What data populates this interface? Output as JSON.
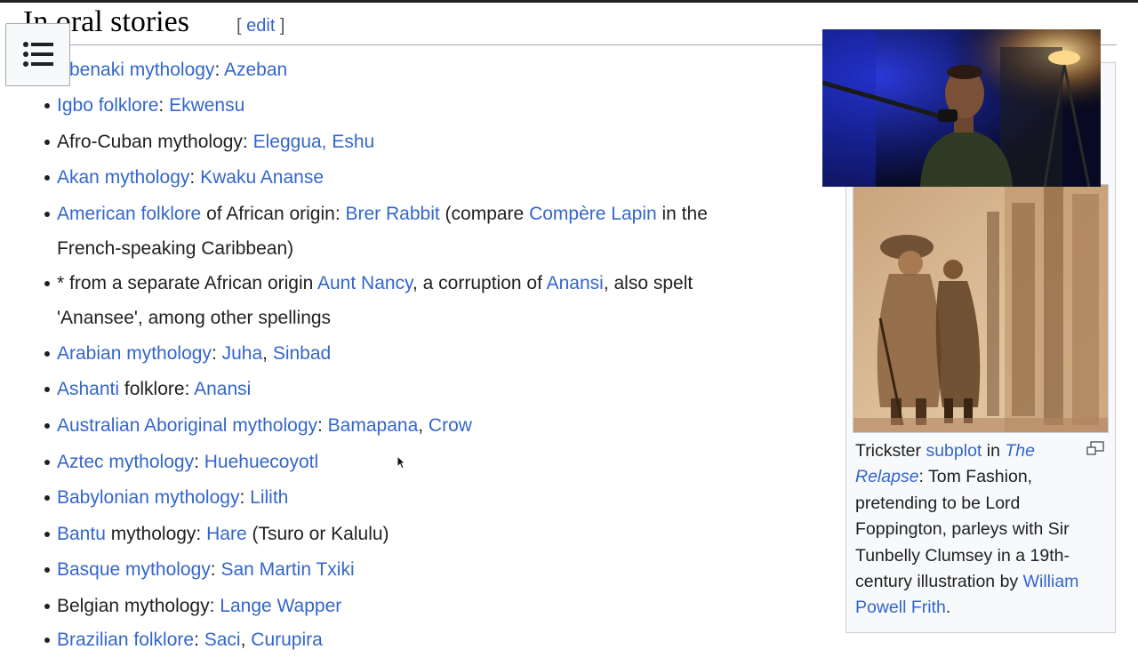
{
  "section": {
    "title": "In oral stories",
    "edit_open": "[ ",
    "edit_label": "edit",
    "edit_close": " ]"
  },
  "toc_button": {
    "icon": "menu-list-icon"
  },
  "items": [
    {
      "segments": [
        {
          "text": "Abenaki mythology",
          "link": true
        },
        {
          "text": ": "
        },
        {
          "text": "Azeban",
          "link": true
        }
      ]
    },
    {
      "segments": [
        {
          "text": "Igbo folklore",
          "link": true
        },
        {
          "text": ": "
        },
        {
          "text": "Ekwensu",
          "link": true
        }
      ]
    },
    {
      "segments": [
        {
          "text": "Afro-Cuban mythology: "
        },
        {
          "text": "Eleggua, Eshu",
          "link": true
        }
      ]
    },
    {
      "segments": [
        {
          "text": "Akan mythology",
          "link": true
        },
        {
          "text": ": "
        },
        {
          "text": "Kwaku Ananse",
          "link": true
        }
      ]
    },
    {
      "segments": [
        {
          "text": "American folklore",
          "link": true
        },
        {
          "text": " of African origin: "
        },
        {
          "text": "Brer Rabbit",
          "link": true
        },
        {
          "text": " (compare "
        },
        {
          "text": "Compère Lapin",
          "link": true
        },
        {
          "text": " in the"
        },
        {
          "text": "French-speaking Caribbean)",
          "newline": true
        }
      ]
    },
    {
      "segments": [
        {
          "text": "* from a separate African origin "
        },
        {
          "text": "Aunt Nancy",
          "link": true
        },
        {
          "text": ", a corruption of "
        },
        {
          "text": "Anansi",
          "link": true
        },
        {
          "text": ", also spelt"
        },
        {
          "text": "'Anansee', among other spellings",
          "newline": true
        }
      ]
    },
    {
      "segments": [
        {
          "text": "Arabian mythology",
          "link": true
        },
        {
          "text": ": "
        },
        {
          "text": "Juha",
          "link": true
        },
        {
          "text": ", "
        },
        {
          "text": "Sinbad",
          "link": true
        }
      ]
    },
    {
      "segments": [
        {
          "text": "Ashanti",
          "link": true
        },
        {
          "text": " folklore: "
        },
        {
          "text": "Anansi",
          "link": true
        }
      ]
    },
    {
      "segments": [
        {
          "text": "Australian Aboriginal mythology",
          "link": true
        },
        {
          "text": ": "
        },
        {
          "text": "Bamapana",
          "link": true
        },
        {
          "text": ", "
        },
        {
          "text": "Crow",
          "link": true
        }
      ]
    },
    {
      "segments": [
        {
          "text": "Aztec mythology",
          "link": true
        },
        {
          "text": ": "
        },
        {
          "text": "Huehuecoyotl",
          "link": true
        }
      ]
    },
    {
      "segments": [
        {
          "text": "Babylonian mythology",
          "link": true
        },
        {
          "text": ": "
        },
        {
          "text": "Lilith",
          "link": true
        }
      ]
    },
    {
      "segments": [
        {
          "text": "Bantu",
          "link": true
        },
        {
          "text": " mythology: "
        },
        {
          "text": "Hare",
          "link": true
        },
        {
          "text": " (Tsuro or Kalulu)"
        }
      ]
    },
    {
      "segments": [
        {
          "text": "Basque mythology",
          "link": true
        },
        {
          "text": ": "
        },
        {
          "text": "San Martin Txiki",
          "link": true
        }
      ]
    },
    {
      "segments": [
        {
          "text": "Belgian mythology: "
        },
        {
          "text": "Lange Wapper",
          "link": true
        }
      ]
    },
    {
      "segments": [
        {
          "text": "Brazilian folklore",
          "link": true
        },
        {
          "text": ": "
        },
        {
          "text": "Saci",
          "link": true
        },
        {
          "text": ", "
        },
        {
          "text": "Curupira",
          "link": true
        }
      ]
    }
  ],
  "infobox": {
    "caption_1": "Trickster ",
    "caption_link_1": "subplot",
    "caption_2": " in ",
    "caption_link_2": "The Relapse",
    "caption_3": ": Tom Fashion, pretending to be Lord Foppington, parleys with Sir Tunbelly Clumsey in a 19th-century illustration by ",
    "caption_link_3": "William Powell Frith",
    "caption_4": ".",
    "enlarge_icon": "enlarge-icon",
    "image_icon": "sepia-illustration"
  },
  "overlay": {
    "webcam_icon": "webcam-person-icon"
  },
  "colors": {
    "link": "#3366cc",
    "text": "#202122",
    "border": "#a2a9b1",
    "infobox_bg": "#f8f9fa"
  }
}
